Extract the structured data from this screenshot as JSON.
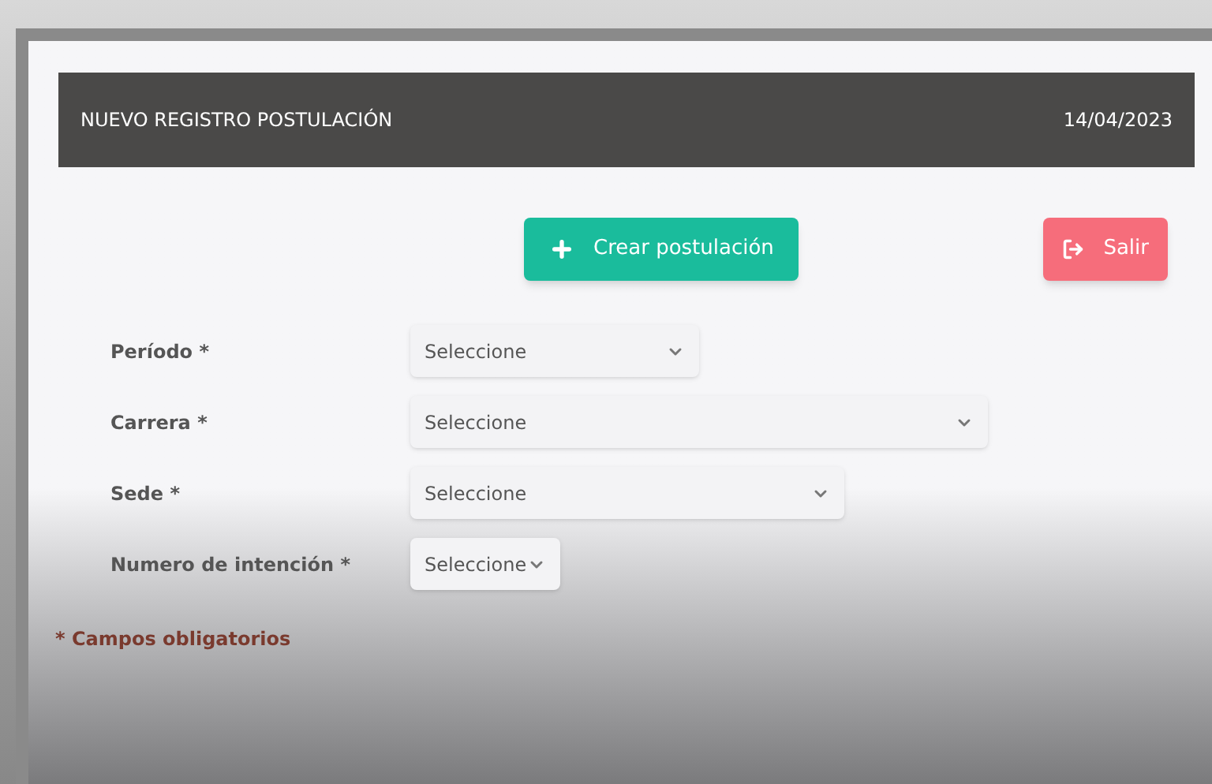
{
  "header": {
    "title": "NUEVO REGISTRO POSTULACIÓN",
    "date": "14/04/2023"
  },
  "buttons": [
    {
      "kind": "create",
      "label": "Crear postulación"
    },
    {
      "kind": "exit",
      "label": "Salir"
    }
  ],
  "fields": [
    {
      "label": "Período",
      "required_mark": "*",
      "placeholder": "Seleccione"
    },
    {
      "label": "Carrera",
      "required_mark": "*",
      "placeholder": "Seleccione"
    },
    {
      "label": "Sede",
      "required_mark": "*",
      "placeholder": "Seleccione"
    },
    {
      "label": "Numero de intención",
      "required_mark": "*",
      "placeholder": "Seleccione"
    }
  ],
  "footnote": "* Campos obligatorios"
}
